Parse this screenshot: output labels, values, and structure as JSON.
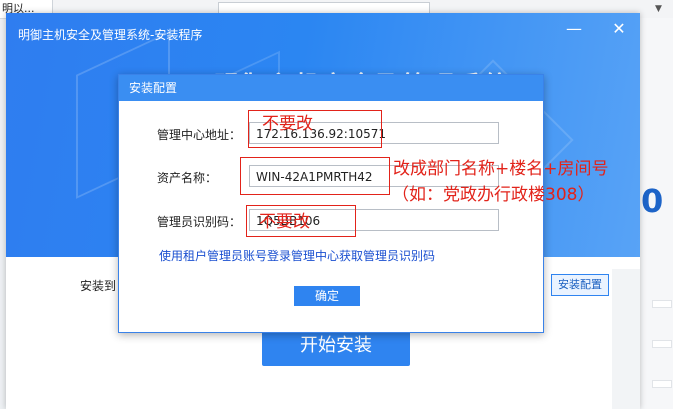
{
  "desktop": {
    "tab_label": "明以...",
    "corner_glyph": "▼",
    "side_number": "0"
  },
  "window": {
    "title": "明御主机安全及管理系统-安装程序",
    "minimize_glyph": "—",
    "close_glyph": "✕",
    "banner_heading": "明御主机安全及管理系统"
  },
  "installer": {
    "install_to_label": "安装到",
    "config_button": "安装配置",
    "start_button": "开始安装"
  },
  "dialog": {
    "title": "安装配置",
    "center_label": "管理中心地址：",
    "center_value": "172.16.136.92:10571",
    "asset_label": "资产名称：",
    "asset_value": "WIN-42A1PMRTH42",
    "admin_label": "管理员识别码：",
    "admin_value": "1Q5BB106",
    "help_link": "使用租户管理员账号登录管理中心获取管理员识别码",
    "ok_button": "确定"
  },
  "annotations": {
    "no_change_1": "不要改",
    "rename_line1": "改成部门名称+楼名+房间号",
    "rename_line2": "（如：党政办行政楼308）",
    "no_change_2": "不要改"
  },
  "colors": {
    "accent": "#2f84f0",
    "annotation": "#e2231a"
  }
}
